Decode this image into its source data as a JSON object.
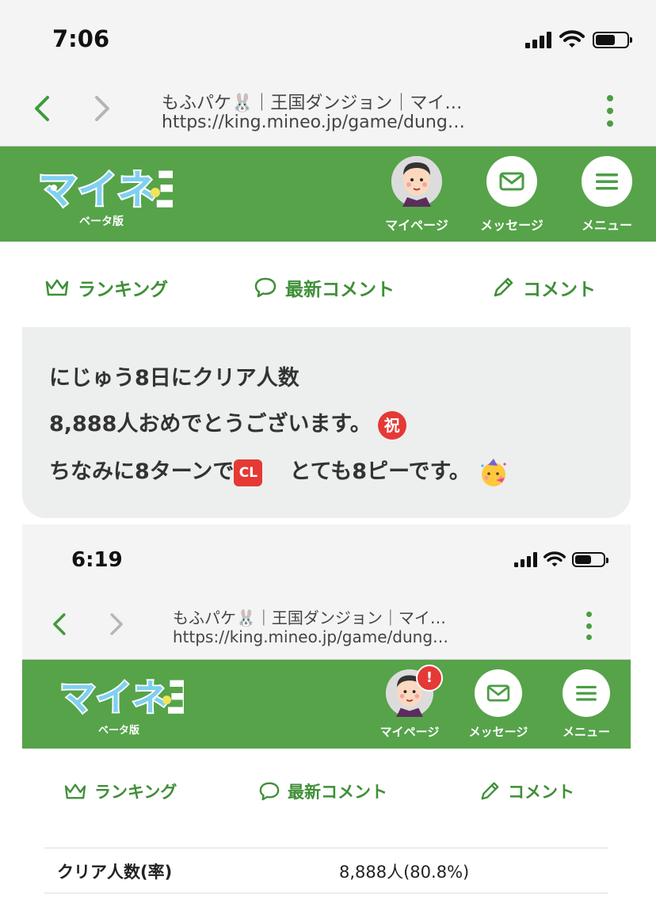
{
  "status_bar": {
    "time": "7:06"
  },
  "browser": {
    "title": "もふパケ🐰｜王国ダンジョン｜マイ…",
    "url": "https://king.mineo.jp/game/dung…"
  },
  "header": {
    "logo_text": "マイネ王",
    "logo_sub": "ベータ版",
    "mypage_label": "マイページ",
    "message_label": "メッセージ",
    "menu_label": "メニュー"
  },
  "tabs": {
    "ranking": "ランキング",
    "latest_comments": "最新コメント",
    "comment": "コメント"
  },
  "comment": {
    "line1": "にじゅう8日にクリア人数",
    "line2": "8,888人おめでとうございます。",
    "line2_emoji": "祝",
    "line3a": "ちなみに8ターンで",
    "line3_emoji": "CL",
    "line3b": "とても8ピーです。"
  },
  "embedded": {
    "status_time": "6:19",
    "browser_title": "もふパケ🐰｜王国ダンジョン｜マイ…",
    "browser_url": "https://king.mineo.jp/game/dung…",
    "logo_sub": "ベータ版",
    "mypage_label": "マイページ",
    "message_label": "メッセージ",
    "menu_label": "メニュー",
    "notification_badge": "!",
    "tab_ranking": "ランキング",
    "tab_latest": "最新コメント",
    "tab_comment": "コメント",
    "stat_label": "クリア人数(率)",
    "stat_value": "8,888人(80.8%)"
  },
  "colors": {
    "brand_green": "#56a34a",
    "link_green": "#3f8f37",
    "bubble_bg": "#ecefee"
  }
}
